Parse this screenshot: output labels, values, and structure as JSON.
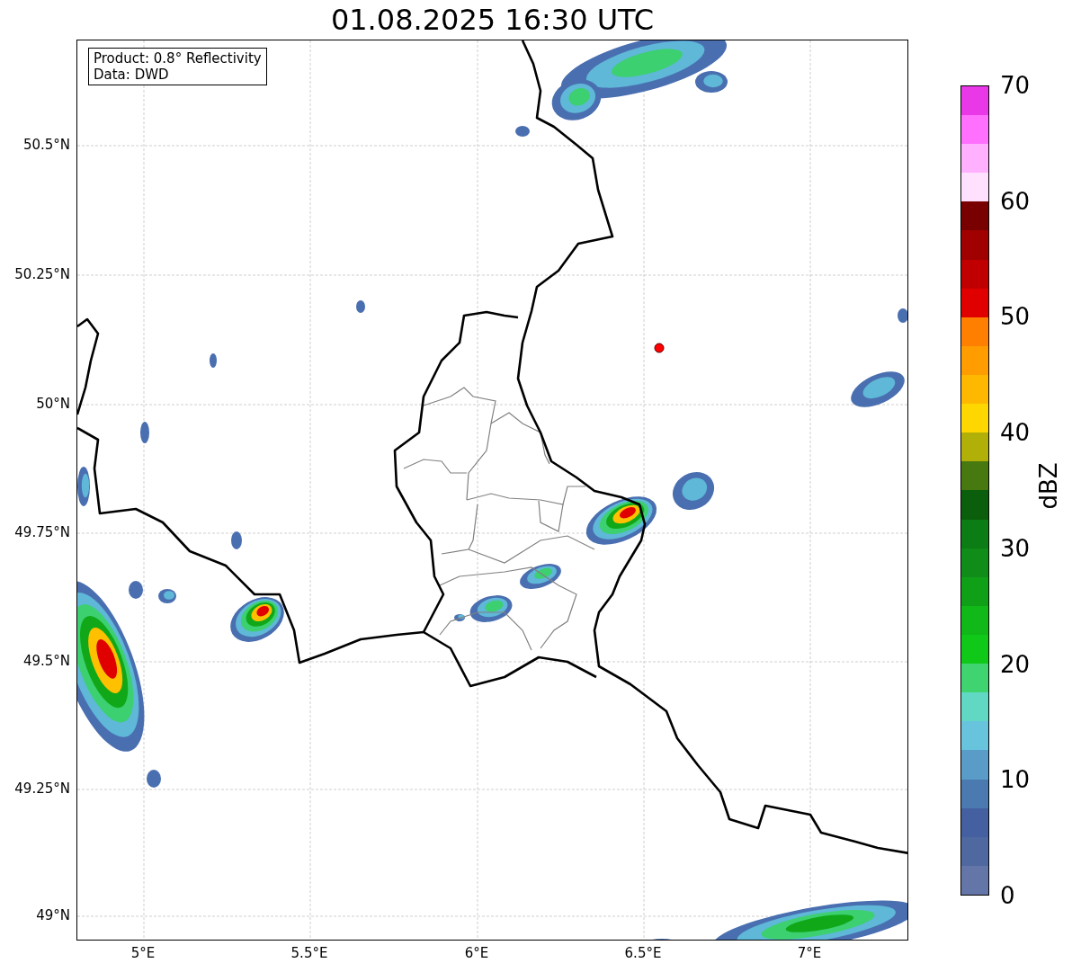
{
  "title": "01.08.2025 16:30 UTC",
  "info_box": {
    "lines": [
      "Product: 0.8° Reflectivity",
      "Data: DWD"
    ]
  },
  "map": {
    "y_ticks": [
      "50.5°N",
      "50.25°N",
      "50°N",
      "49.75°N",
      "49.5°N",
      "49.25°N",
      "49°N"
    ],
    "x_ticks": [
      "5°E",
      "5.5°E",
      "6°E",
      "6.5°E",
      "7°E"
    ]
  },
  "colorbar": {
    "label": "dBZ",
    "ticks": [
      "70",
      "60",
      "50",
      "40",
      "30",
      "20",
      "10",
      "0"
    ],
    "segments": [
      {
        "color": "#6476a8"
      },
      {
        "color": "#5068a0"
      },
      {
        "color": "#4460a0"
      },
      {
        "color": "#4a7ab0"
      },
      {
        "color": "#5a9cc8"
      },
      {
        "color": "#68c4dc"
      },
      {
        "color": "#60d8c4"
      },
      {
        "color": "#40d470"
      },
      {
        "color": "#10c818"
      },
      {
        "color": "#10b818"
      },
      {
        "color": "#10a018"
      },
      {
        "color": "#108c18"
      },
      {
        "color": "#0c7c14"
      },
      {
        "color": "#0a5e0c"
      },
      {
        "color": "#487810"
      },
      {
        "color": "#b0b008"
      },
      {
        "color": "#ffd700"
      },
      {
        "color": "#ffb800"
      },
      {
        "color": "#ff9c00"
      },
      {
        "color": "#ff8000"
      },
      {
        "color": "#e00000"
      },
      {
        "color": "#c00000"
      },
      {
        "color": "#a00000"
      },
      {
        "color": "#780000"
      },
      {
        "color": "#ffe0ff"
      },
      {
        "color": "#ffb0ff"
      },
      {
        "color": "#ff70ff"
      },
      {
        "color": "#e838e8"
      }
    ]
  }
}
